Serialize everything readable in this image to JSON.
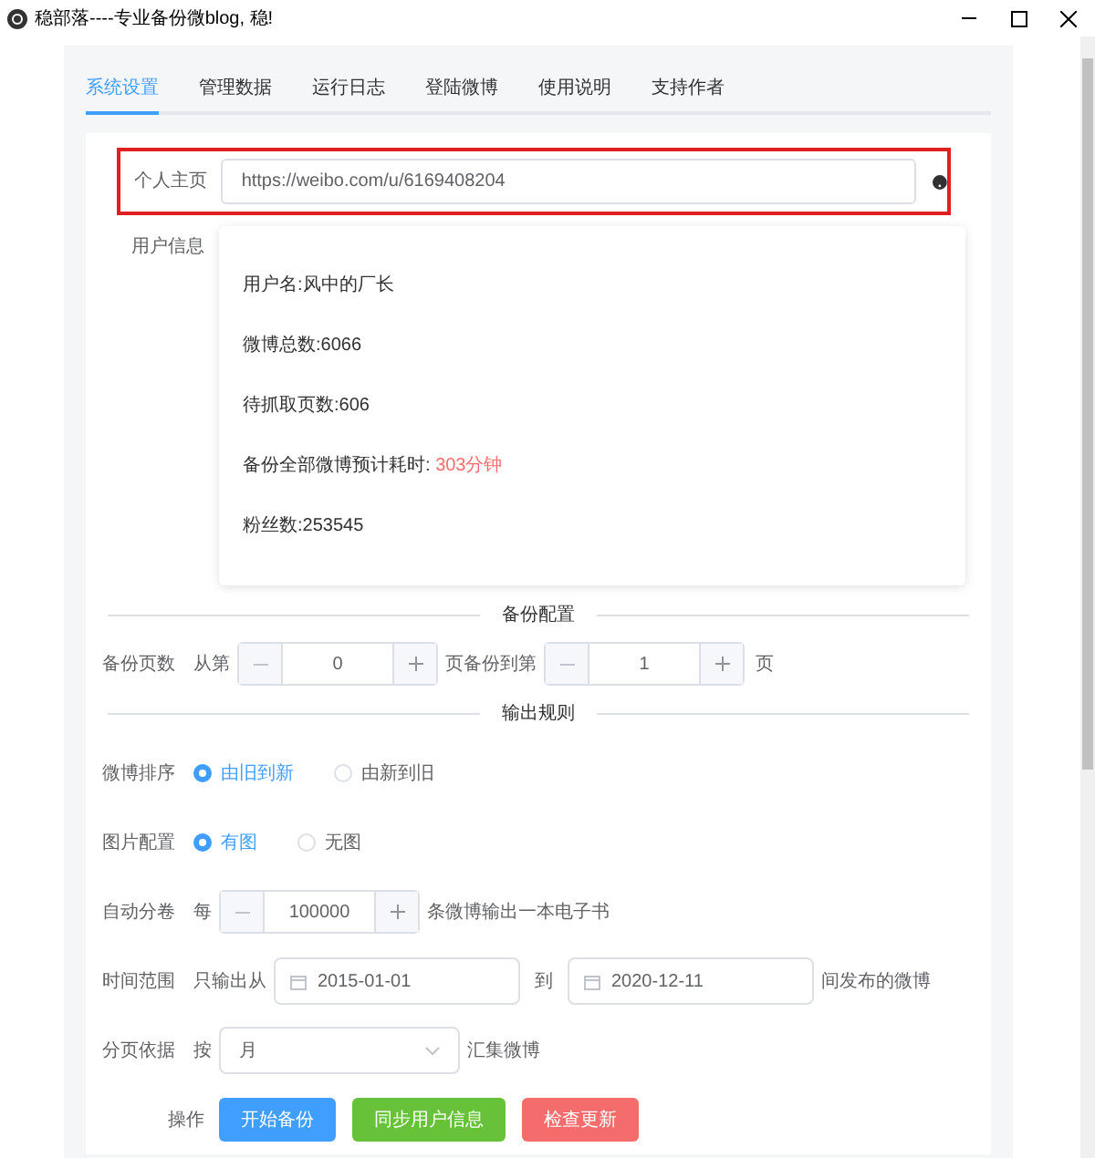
{
  "window": {
    "title": "稳部落----专业备份微blog, 稳!"
  },
  "tabs": [
    {
      "label": "系统设置",
      "selected": true
    },
    {
      "label": "管理数据",
      "selected": false
    },
    {
      "label": "运行日志",
      "selected": false
    },
    {
      "label": "登陆微博",
      "selected": false
    },
    {
      "label": "使用说明",
      "selected": false
    },
    {
      "label": "支持作者",
      "selected": false
    }
  ],
  "homepage": {
    "label": "个人主页",
    "value": "https://weibo.com/u/6169408204",
    "highlighted": true
  },
  "user_info": {
    "label": "用户信息",
    "lines": [
      {
        "text": "用户名:风中的厂长"
      },
      {
        "text": "微博总数:6066"
      },
      {
        "text": "待抓取页数:606"
      },
      {
        "text": "备份全部微博预计耗时: ",
        "highlight": "303分钟"
      },
      {
        "text": "粉丝数:253545"
      }
    ]
  },
  "sections": [
    {
      "title": "备份配置"
    },
    {
      "title": "输出规则"
    }
  ],
  "page_range": {
    "label": "备份页数",
    "prefix": "从第",
    "from": "0",
    "middle": "页备份到第",
    "to": "1",
    "suffix": "页"
  },
  "sort": {
    "label": "微博排序",
    "options": [
      {
        "label": "由旧到新",
        "selected": true
      },
      {
        "label": "由新到旧",
        "selected": false
      }
    ]
  },
  "images": {
    "label": "图片配置",
    "options": [
      {
        "label": "有图",
        "selected": true
      },
      {
        "label": "无图",
        "selected": false
      }
    ]
  },
  "split": {
    "label": "自动分卷",
    "prefix": "每",
    "value": "100000",
    "suffix": "条微博输出一本电子书"
  },
  "time_range": {
    "label": "时间范围",
    "prefix": "只输出从",
    "from": "2015-01-01",
    "middle": "到",
    "to": "2020-12-11",
    "suffix": "间发布的微博"
  },
  "paging": {
    "label": "分页依据",
    "prefix": "按",
    "value": "月",
    "suffix": "汇集微博"
  },
  "actions": {
    "label": "操作",
    "buttons": [
      {
        "label": "开始备份",
        "kind": "primary"
      },
      {
        "label": "同步用户信息",
        "kind": "success"
      },
      {
        "label": "检查更新",
        "kind": "danger"
      }
    ]
  }
}
